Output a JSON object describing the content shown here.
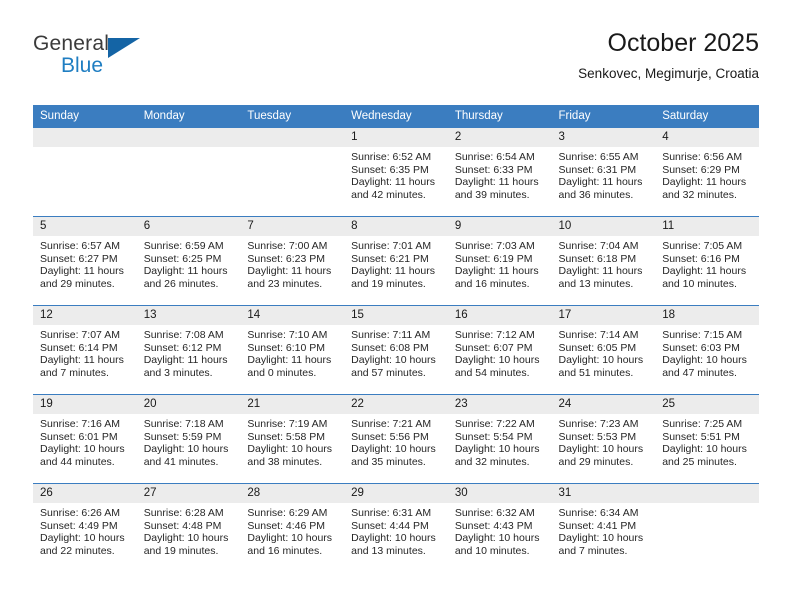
{
  "brand": {
    "word_general": "General",
    "word_blue": "Blue",
    "triangle_color": "#1464a5"
  },
  "header": {
    "title": "October 2025",
    "subtitle": "Senkovec, Megimurje, Croatia"
  },
  "theme": {
    "header_blue": "#3b7dc0",
    "daynum_gray": "#ececec",
    "text": "#262626"
  },
  "weekday_headers": [
    "Sunday",
    "Monday",
    "Tuesday",
    "Wednesday",
    "Thursday",
    "Friday",
    "Saturday"
  ],
  "weeks": [
    [
      {
        "day": "",
        "sunrise": "",
        "sunset": "",
        "daylight1": "",
        "daylight2": "",
        "empty": true
      },
      {
        "day": "",
        "sunrise": "",
        "sunset": "",
        "daylight1": "",
        "daylight2": "",
        "empty": true
      },
      {
        "day": "",
        "sunrise": "",
        "sunset": "",
        "daylight1": "",
        "daylight2": "",
        "empty": true
      },
      {
        "day": "1",
        "sunrise": "Sunrise: 6:52 AM",
        "sunset": "Sunset: 6:35 PM",
        "daylight1": "Daylight: 11 hours",
        "daylight2": "and 42 minutes."
      },
      {
        "day": "2",
        "sunrise": "Sunrise: 6:54 AM",
        "sunset": "Sunset: 6:33 PM",
        "daylight1": "Daylight: 11 hours",
        "daylight2": "and 39 minutes."
      },
      {
        "day": "3",
        "sunrise": "Sunrise: 6:55 AM",
        "sunset": "Sunset: 6:31 PM",
        "daylight1": "Daylight: 11 hours",
        "daylight2": "and 36 minutes."
      },
      {
        "day": "4",
        "sunrise": "Sunrise: 6:56 AM",
        "sunset": "Sunset: 6:29 PM",
        "daylight1": "Daylight: 11 hours",
        "daylight2": "and 32 minutes."
      }
    ],
    [
      {
        "day": "5",
        "sunrise": "Sunrise: 6:57 AM",
        "sunset": "Sunset: 6:27 PM",
        "daylight1": "Daylight: 11 hours",
        "daylight2": "and 29 minutes."
      },
      {
        "day": "6",
        "sunrise": "Sunrise: 6:59 AM",
        "sunset": "Sunset: 6:25 PM",
        "daylight1": "Daylight: 11 hours",
        "daylight2": "and 26 minutes."
      },
      {
        "day": "7",
        "sunrise": "Sunrise: 7:00 AM",
        "sunset": "Sunset: 6:23 PM",
        "daylight1": "Daylight: 11 hours",
        "daylight2": "and 23 minutes."
      },
      {
        "day": "8",
        "sunrise": "Sunrise: 7:01 AM",
        "sunset": "Sunset: 6:21 PM",
        "daylight1": "Daylight: 11 hours",
        "daylight2": "and 19 minutes."
      },
      {
        "day": "9",
        "sunrise": "Sunrise: 7:03 AM",
        "sunset": "Sunset: 6:19 PM",
        "daylight1": "Daylight: 11 hours",
        "daylight2": "and 16 minutes."
      },
      {
        "day": "10",
        "sunrise": "Sunrise: 7:04 AM",
        "sunset": "Sunset: 6:18 PM",
        "daylight1": "Daylight: 11 hours",
        "daylight2": "and 13 minutes."
      },
      {
        "day": "11",
        "sunrise": "Sunrise: 7:05 AM",
        "sunset": "Sunset: 6:16 PM",
        "daylight1": "Daylight: 11 hours",
        "daylight2": "and 10 minutes."
      }
    ],
    [
      {
        "day": "12",
        "sunrise": "Sunrise: 7:07 AM",
        "sunset": "Sunset: 6:14 PM",
        "daylight1": "Daylight: 11 hours",
        "daylight2": "and 7 minutes."
      },
      {
        "day": "13",
        "sunrise": "Sunrise: 7:08 AM",
        "sunset": "Sunset: 6:12 PM",
        "daylight1": "Daylight: 11 hours",
        "daylight2": "and 3 minutes."
      },
      {
        "day": "14",
        "sunrise": "Sunrise: 7:10 AM",
        "sunset": "Sunset: 6:10 PM",
        "daylight1": "Daylight: 11 hours",
        "daylight2": "and 0 minutes."
      },
      {
        "day": "15",
        "sunrise": "Sunrise: 7:11 AM",
        "sunset": "Sunset: 6:08 PM",
        "daylight1": "Daylight: 10 hours",
        "daylight2": "and 57 minutes."
      },
      {
        "day": "16",
        "sunrise": "Sunrise: 7:12 AM",
        "sunset": "Sunset: 6:07 PM",
        "daylight1": "Daylight: 10 hours",
        "daylight2": "and 54 minutes."
      },
      {
        "day": "17",
        "sunrise": "Sunrise: 7:14 AM",
        "sunset": "Sunset: 6:05 PM",
        "daylight1": "Daylight: 10 hours",
        "daylight2": "and 51 minutes."
      },
      {
        "day": "18",
        "sunrise": "Sunrise: 7:15 AM",
        "sunset": "Sunset: 6:03 PM",
        "daylight1": "Daylight: 10 hours",
        "daylight2": "and 47 minutes."
      }
    ],
    [
      {
        "day": "19",
        "sunrise": "Sunrise: 7:16 AM",
        "sunset": "Sunset: 6:01 PM",
        "daylight1": "Daylight: 10 hours",
        "daylight2": "and 44 minutes."
      },
      {
        "day": "20",
        "sunrise": "Sunrise: 7:18 AM",
        "sunset": "Sunset: 5:59 PM",
        "daylight1": "Daylight: 10 hours",
        "daylight2": "and 41 minutes."
      },
      {
        "day": "21",
        "sunrise": "Sunrise: 7:19 AM",
        "sunset": "Sunset: 5:58 PM",
        "daylight1": "Daylight: 10 hours",
        "daylight2": "and 38 minutes."
      },
      {
        "day": "22",
        "sunrise": "Sunrise: 7:21 AM",
        "sunset": "Sunset: 5:56 PM",
        "daylight1": "Daylight: 10 hours",
        "daylight2": "and 35 minutes."
      },
      {
        "day": "23",
        "sunrise": "Sunrise: 7:22 AM",
        "sunset": "Sunset: 5:54 PM",
        "daylight1": "Daylight: 10 hours",
        "daylight2": "and 32 minutes."
      },
      {
        "day": "24",
        "sunrise": "Sunrise: 7:23 AM",
        "sunset": "Sunset: 5:53 PM",
        "daylight1": "Daylight: 10 hours",
        "daylight2": "and 29 minutes."
      },
      {
        "day": "25",
        "sunrise": "Sunrise: 7:25 AM",
        "sunset": "Sunset: 5:51 PM",
        "daylight1": "Daylight: 10 hours",
        "daylight2": "and 25 minutes."
      }
    ],
    [
      {
        "day": "26",
        "sunrise": "Sunrise: 6:26 AM",
        "sunset": "Sunset: 4:49 PM",
        "daylight1": "Daylight: 10 hours",
        "daylight2": "and 22 minutes."
      },
      {
        "day": "27",
        "sunrise": "Sunrise: 6:28 AM",
        "sunset": "Sunset: 4:48 PM",
        "daylight1": "Daylight: 10 hours",
        "daylight2": "and 19 minutes."
      },
      {
        "day": "28",
        "sunrise": "Sunrise: 6:29 AM",
        "sunset": "Sunset: 4:46 PM",
        "daylight1": "Daylight: 10 hours",
        "daylight2": "and 16 minutes."
      },
      {
        "day": "29",
        "sunrise": "Sunrise: 6:31 AM",
        "sunset": "Sunset: 4:44 PM",
        "daylight1": "Daylight: 10 hours",
        "daylight2": "and 13 minutes."
      },
      {
        "day": "30",
        "sunrise": "Sunrise: 6:32 AM",
        "sunset": "Sunset: 4:43 PM",
        "daylight1": "Daylight: 10 hours",
        "daylight2": "and 10 minutes."
      },
      {
        "day": "31",
        "sunrise": "Sunrise: 6:34 AM",
        "sunset": "Sunset: 4:41 PM",
        "daylight1": "Daylight: 10 hours",
        "daylight2": "and 7 minutes."
      },
      {
        "day": "",
        "sunrise": "",
        "sunset": "",
        "daylight1": "",
        "daylight2": "",
        "empty": true
      }
    ]
  ]
}
